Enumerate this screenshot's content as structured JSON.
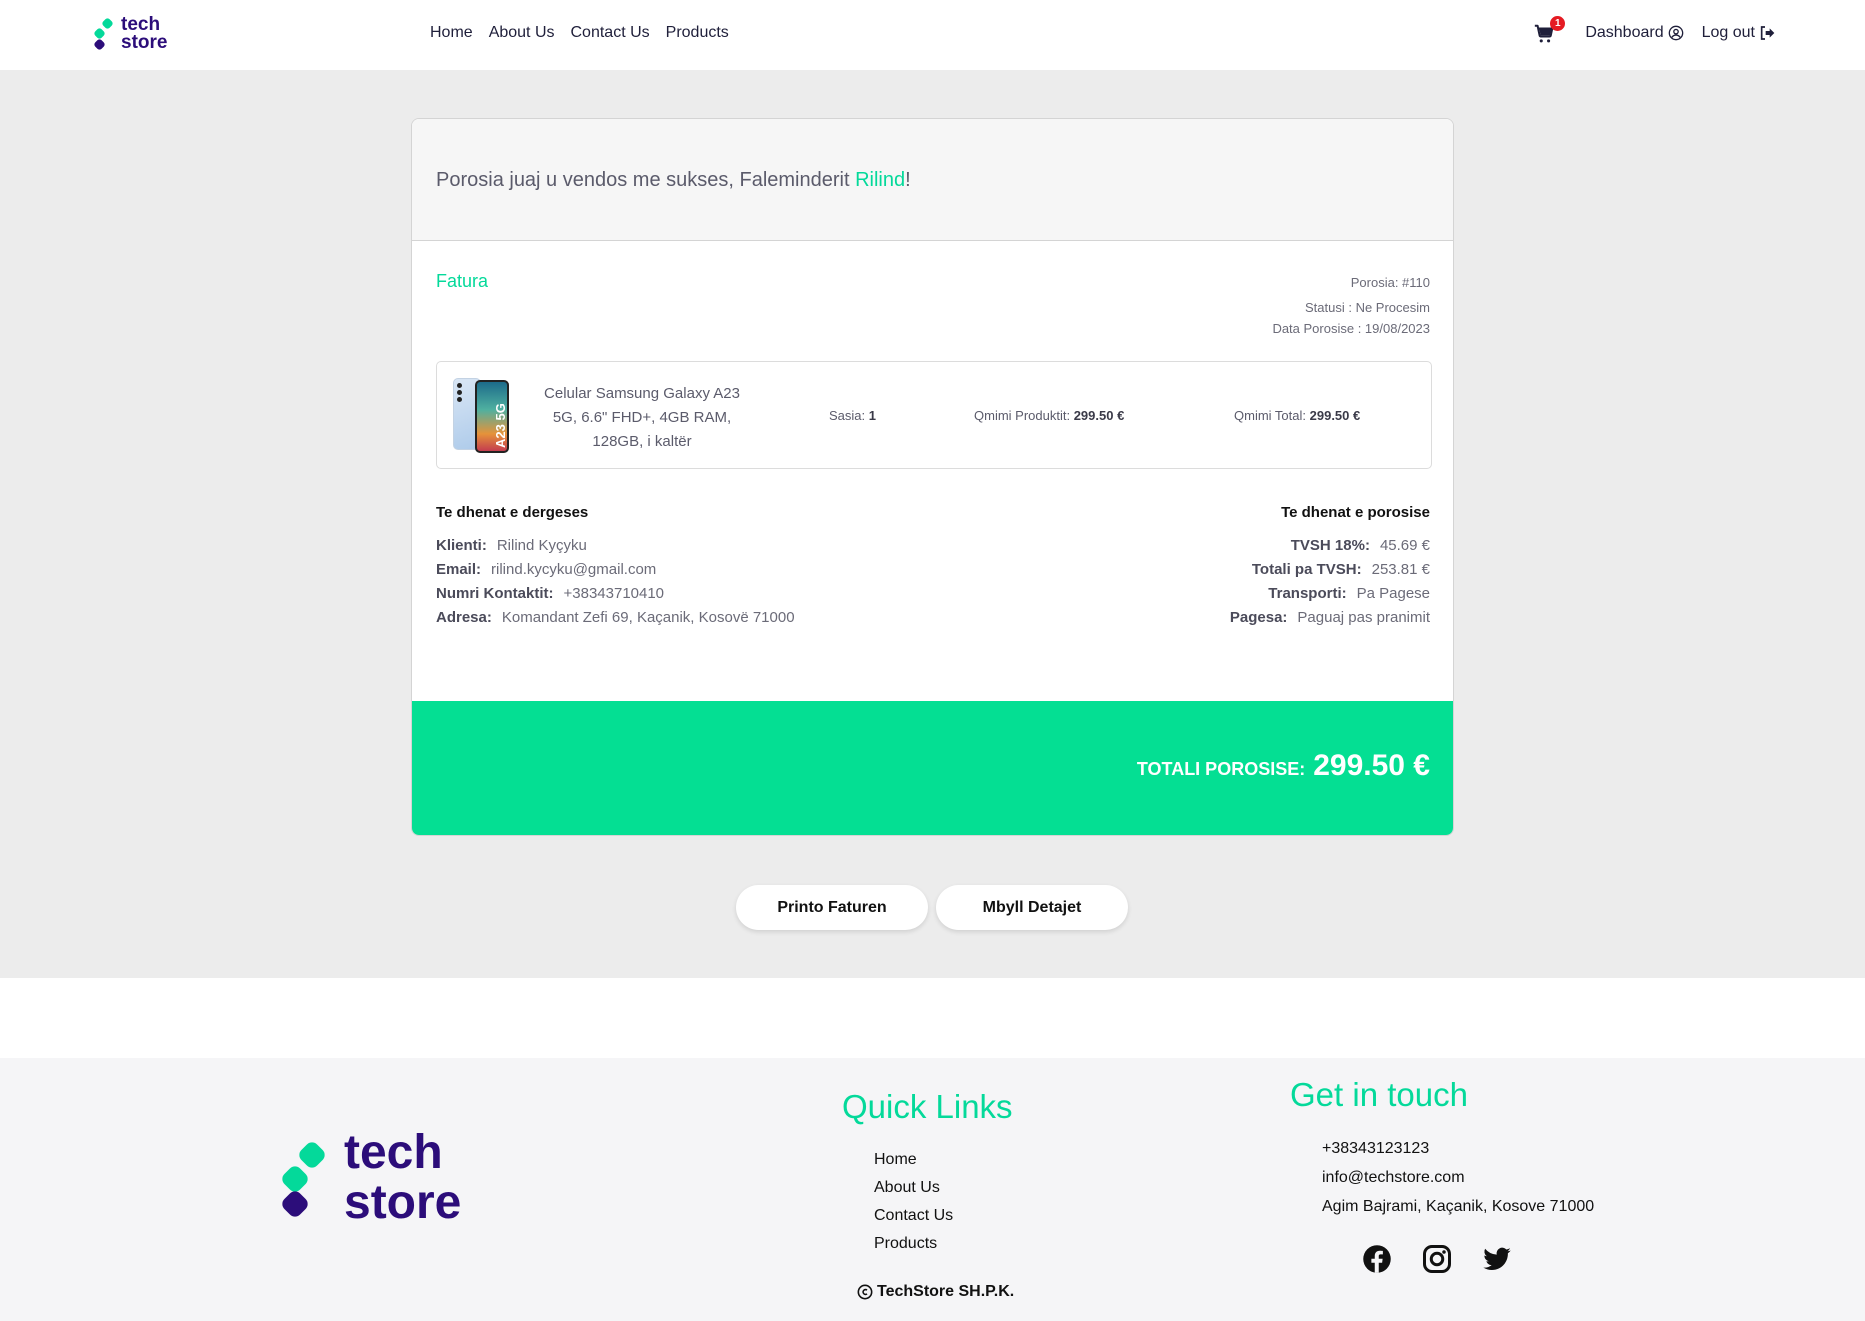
{
  "brand": {
    "line1": "tech",
    "line2": "store"
  },
  "nav": {
    "links": [
      "Home",
      "About Us",
      "Contact Us",
      "Products"
    ],
    "cart_count": "1",
    "dashboard": "Dashboard",
    "logout": "Log out"
  },
  "confirmation": {
    "message": "Porosia juaj u vendos me sukses, Faleminderit ",
    "customer_first_name": "Rilind",
    "suffix": "!"
  },
  "invoice": {
    "title": "Fatura",
    "order_number": "Porosia: #110",
    "status": "Statusi : Ne Procesim",
    "order_date": "Data Porosise : 19/08/2023",
    "item": {
      "image_label": "A23 5G",
      "name": "Celular Samsung Galaxy A23 5G, 6.6\" FHD+, 4GB RAM, 128GB, i kaltër",
      "qty_label": "Sasia:",
      "qty": "1",
      "price_label": "Qmimi Produktit:",
      "price": "299.50 €",
      "total_label": "Qmimi Total:",
      "total": "299.50 €"
    },
    "shipping": {
      "title": "Te dhenat e dergeses",
      "rows": [
        {
          "k": "Klienti:",
          "v": "Rilind Kyçyku"
        },
        {
          "k": "Email:",
          "v": "rilind.kycyku@gmail.com"
        },
        {
          "k": "Numri Kontaktit:",
          "v": "+38343710410"
        },
        {
          "k": "Adresa:",
          "v": "Komandant Zefi 69, Kaçanik, Kosovë 71000"
        }
      ]
    },
    "order_details": {
      "title": "Te dhenat e porosise",
      "rows": [
        {
          "k": "TVSH 18%:",
          "v": "45.69 €"
        },
        {
          "k": "Totali pa TVSH:",
          "v": "253.81 €"
        },
        {
          "k": "Transporti:",
          "v": "Pa Pagese"
        },
        {
          "k": "Pagesa:",
          "v": "Paguaj pas pranimit"
        }
      ]
    },
    "grand_total_label": "TOTALI POROSISE:",
    "grand_total": "299.50 €"
  },
  "actions": {
    "print": "Printo Faturen",
    "close": "Mbyll Detajet"
  },
  "footer": {
    "quick_links_title": "Quick Links",
    "quick_links": [
      "Home",
      "About Us",
      "Contact Us",
      "Products"
    ],
    "contact_title": "Get in touch",
    "phone": "+38343123123",
    "email": "info@techstore.com",
    "address": "Agim Bajrami, Kaçanik, Kosove 71000",
    "social": [
      "facebook-icon",
      "instagram-icon",
      "twitter-icon"
    ],
    "copyright": "TechStore SH.P.K."
  },
  "colors": {
    "accent": "#04d99a",
    "brand": "#2c0d7a",
    "total_bar": "#04df93"
  }
}
